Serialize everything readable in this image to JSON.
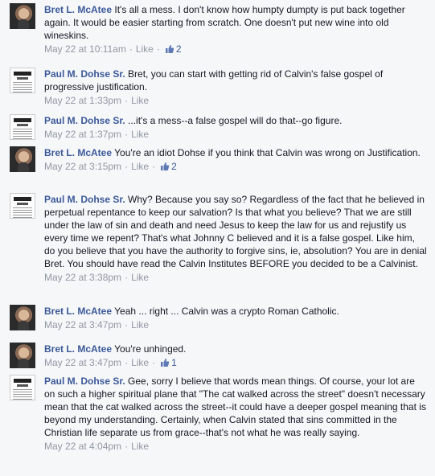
{
  "comments": [
    {
      "author": "Bret L. McAtee",
      "avatar": "bret",
      "text": "It's all a mess. I don't know how humpty dumpty is put back together again. It would be easier starting from scratch. One doesn't put new wine into old wineskins.",
      "timestamp": "May 22 at 10:11am",
      "like_label": "Like",
      "like_count": "2"
    },
    {
      "author": "Paul M. Dohse Sr.",
      "avatar": "paul",
      "text": "Bret, you can start with getting rid of Calvin's false gospel of progressive justification.",
      "timestamp": "May 22 at 1:33pm",
      "like_label": "Like",
      "like_count": ""
    },
    {
      "author": "Paul M. Dohse Sr.",
      "avatar": "paul",
      "text": "...it's a mess--a false gospel will do that--go figure.",
      "timestamp": "May 22 at 1:37pm",
      "like_label": "Like",
      "like_count": ""
    },
    {
      "author": "Bret L. McAtee",
      "avatar": "bret",
      "text": "You're an idiot Dohse if you think that Calvin was wrong on Justification.",
      "timestamp": "May 22 at 3:15pm",
      "like_label": "Like",
      "like_count": "2"
    },
    {
      "author": "Paul M. Dohse Sr.",
      "avatar": "paul",
      "text": "Why? Because you say so? Regardless of the fact that he believed in perpetual repentance to keep our salvation? Is that what you believe? That we are still under the law of sin and death and need Jesus to keep the law for us and rejustify us every time we repent? That's what Johnny C believed and it is a false gospel. Like him, do you believe that you have the authority to forgive sins, ie, absolution? You are in denial Bret. You should have read the Calvin Institutes BEFORE you decided to be a Calvinist.",
      "timestamp": "May 22 at 3:38pm",
      "like_label": "Like",
      "like_count": ""
    },
    {
      "author": "Bret L. McAtee",
      "avatar": "bret",
      "text": "Yeah ... right ... Calvin was a crypto Roman Catholic.",
      "timestamp": "May 22 at 3:47pm",
      "like_label": "Like",
      "like_count": ""
    },
    {
      "author": "Bret L. McAtee",
      "avatar": "bret",
      "text": "You're unhinged.",
      "timestamp": "May 22 at 3:47pm",
      "like_label": "Like",
      "like_count": "1"
    },
    {
      "author": "Paul M. Dohse Sr.",
      "avatar": "paul",
      "text": "Gee, sorry I believe that words mean things. Of course, your lot are on such a higher spiritual plane that \"The cat walked across the street\" doesn't necessary mean that the cat walked across the street--it could have a deeper gospel meaning that is beyond my understanding. Certainly, when Calvin stated that sins committed in the Christian life separate us from grace--that's not what he was really saying.",
      "timestamp": "May 22 at 4:04pm",
      "like_label": "Like",
      "like_count": ""
    }
  ],
  "colors": {
    "author": "#3b5998",
    "meta": "#9197a3",
    "text": "#141823",
    "background": "#f6f7f9"
  },
  "icons": {
    "like": "thumbs-up-icon"
  }
}
